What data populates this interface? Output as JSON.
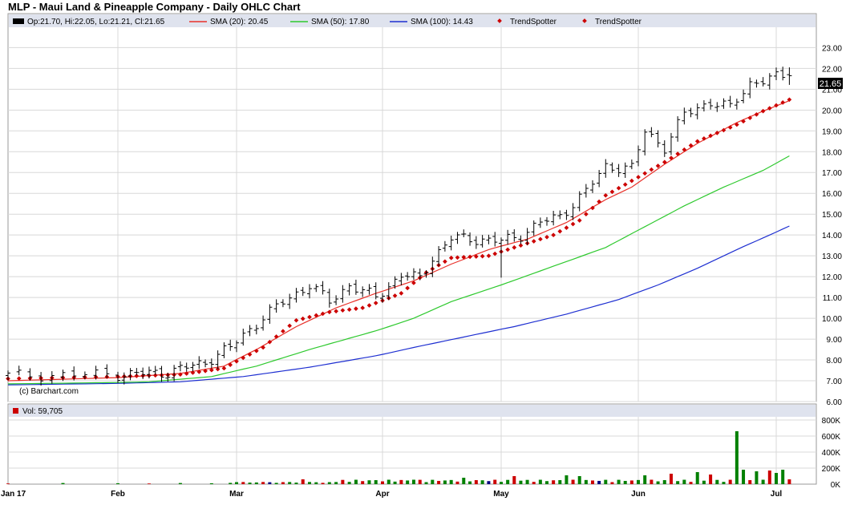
{
  "page": {
    "title": "MLP - Maui Land & Pineapple Company - Daily OHLC Chart"
  },
  "legend": {
    "ohlc": "Op:21.70, Hi:22.05, Lo:21.21, Cl:21.65",
    "sma20": "SMA (20): 20.45",
    "sma50": "SMA (50): 17.80",
    "sma100": "SMA (100): 14.43",
    "trend1": "TrendSpotter",
    "trend2": "TrendSpotter"
  },
  "volume_legend": "Vol: 59,705",
  "copyright": "(c) Barchart.com",
  "last_price_label": "21.65",
  "colors": {
    "price": "#000000",
    "sma20": "#e8312a",
    "sma50": "#2ec92e",
    "sma100": "#1e2fd1",
    "trendspotter": "#cc0000",
    "volume_up": "#008000",
    "volume_down": "#cc0000",
    "volume_neutral": "#000080",
    "grid": "#d8d8d8",
    "legend_bg": "#dfe3ee"
  },
  "chart_data": [
    {
      "type": "ohlc",
      "title": "MLP - Maui Land & Pineapple Company - Daily OHLC Chart",
      "y_ticks": [
        "6.00",
        "7.00",
        "8.00",
        "9.00",
        "10.00",
        "11.00",
        "12.00",
        "13.00",
        "14.00",
        "15.00",
        "16.00",
        "17.00",
        "18.00",
        "19.00",
        "20.00",
        "21.00",
        "22.00",
        "23.00"
      ],
      "ylim": [
        6,
        23.9
      ],
      "x_ticks": [
        "Jan 17",
        "Feb",
        "Mar",
        "Apr",
        "May",
        "Jun",
        "Jul"
      ],
      "grid": true,
      "x_anchors": [
        {
          "label": "Jan 17",
          "day": 0
        },
        {
          "label": "Feb",
          "day": 10
        },
        {
          "label": "Mar",
          "day": 29
        },
        {
          "label": "Apr",
          "day": 51
        },
        {
          "label": "May",
          "day": 70
        },
        {
          "label": "Jun",
          "day": 91
        },
        {
          "label": "Jul",
          "day": 112
        }
      ],
      "key_points": [
        {
          "day": 0,
          "close": 7.25
        },
        {
          "day": 10,
          "close": 7.3
        },
        {
          "day": 18,
          "close": 7.4
        },
        {
          "day": 24,
          "close": 7.9
        },
        {
          "day": 28,
          "close": 8.6
        },
        {
          "day": 31,
          "close": 9.5
        },
        {
          "day": 36,
          "close": 10.8
        },
        {
          "day": 40,
          "close": 11.6
        },
        {
          "day": 43,
          "close": 10.8
        },
        {
          "day": 46,
          "close": 11.6
        },
        {
          "day": 50,
          "close": 11.0
        },
        {
          "day": 54,
          "close": 12.1
        },
        {
          "day": 57,
          "close": 11.9
        },
        {
          "day": 59,
          "close": 12.9
        },
        {
          "day": 62,
          "close": 13.85
        },
        {
          "day": 66,
          "close": 13.8
        },
        {
          "day": 70,
          "close": 13.7
        },
        {
          "day": 73,
          "close": 14.0
        },
        {
          "day": 76,
          "close": 14.6
        },
        {
          "day": 79,
          "close": 14.9
        },
        {
          "day": 83,
          "close": 16.1
        },
        {
          "day": 86,
          "close": 17.3
        },
        {
          "day": 90,
          "close": 17.2
        },
        {
          "day": 92,
          "close": 19.0
        },
        {
          "day": 95,
          "close": 18.2
        },
        {
          "day": 98,
          "close": 19.8
        },
        {
          "day": 102,
          "close": 20.4
        },
        {
          "day": 105,
          "close": 20.1
        },
        {
          "day": 108,
          "close": 21.3
        },
        {
          "day": 111,
          "close": 21.5
        },
        {
          "day": 114,
          "close": 21.65
        }
      ],
      "last": {
        "open": 21.7,
        "high": 22.05,
        "low": 21.21,
        "close": 21.65
      },
      "series": [
        {
          "name": "SMA (20)",
          "points": [
            [
              0,
              7.0
            ],
            [
              10,
              7.15
            ],
            [
              20,
              7.35
            ],
            [
              27,
              7.7
            ],
            [
              32,
              8.5
            ],
            [
              38,
              9.6
            ],
            [
              44,
              10.5
            ],
            [
              50,
              11.2
            ],
            [
              56,
              11.8
            ],
            [
              62,
              12.6
            ],
            [
              68,
              13.3
            ],
            [
              74,
              13.8
            ],
            [
              80,
              14.6
            ],
            [
              86,
              15.7
            ],
            [
              90,
              16.3
            ],
            [
              95,
              17.4
            ],
            [
              100,
              18.4
            ],
            [
              106,
              19.4
            ],
            [
              110,
              19.95
            ],
            [
              114,
              20.45
            ]
          ]
        },
        {
          "name": "SMA (50)",
          "points": [
            [
              0,
              6.85
            ],
            [
              15,
              6.95
            ],
            [
              25,
              7.2
            ],
            [
              32,
              7.7
            ],
            [
              40,
              8.5
            ],
            [
              50,
              9.4
            ],
            [
              56,
              10.0
            ],
            [
              62,
              10.8
            ],
            [
              70,
              11.6
            ],
            [
              78,
              12.5
            ],
            [
              86,
              13.4
            ],
            [
              92,
              14.4
            ],
            [
              98,
              15.4
            ],
            [
              104,
              16.3
            ],
            [
              110,
              17.1
            ],
            [
              114,
              17.8
            ]
          ]
        },
        {
          "name": "SMA (100)",
          "points": [
            [
              0,
              6.8
            ],
            [
              20,
              6.95
            ],
            [
              30,
              7.2
            ],
            [
              40,
              7.65
            ],
            [
              50,
              8.2
            ],
            [
              56,
              8.6
            ],
            [
              64,
              9.1
            ],
            [
              72,
              9.6
            ],
            [
              80,
              10.2
            ],
            [
              88,
              10.9
            ],
            [
              94,
              11.6
            ],
            [
              100,
              12.4
            ],
            [
              106,
              13.3
            ],
            [
              111,
              14.0
            ],
            [
              114,
              14.43
            ]
          ]
        },
        {
          "name": "TrendSpotter",
          "points": [
            [
              0,
              7.1
            ],
            [
              10,
              7.2
            ],
            [
              20,
              7.3
            ],
            [
              27,
              7.6
            ],
            [
              33,
              8.6
            ],
            [
              38,
              9.9
            ],
            [
              43,
              10.3
            ],
            [
              48,
              10.5
            ],
            [
              54,
              11.2
            ],
            [
              58,
              12.2
            ],
            [
              62,
              12.9
            ],
            [
              68,
              13.0
            ],
            [
              72,
              13.4
            ],
            [
              78,
              14.0
            ],
            [
              82,
              14.7
            ],
            [
              86,
              15.9
            ],
            [
              90,
              16.6
            ],
            [
              95,
              17.5
            ],
            [
              100,
              18.5
            ],
            [
              106,
              19.3
            ],
            [
              110,
              19.95
            ],
            [
              114,
              20.5
            ]
          ]
        }
      ]
    },
    {
      "type": "bar",
      "title": "Volume",
      "y_ticks": [
        "0K",
        "200K",
        "400K",
        "600K",
        "800K"
      ],
      "ylim": [
        0,
        800000
      ],
      "last_volume": 59705,
      "spikes": [
        {
          "day": 39,
          "value": 60000
        },
        {
          "day": 56,
          "value": 55000
        },
        {
          "day": 64,
          "value": 80000
        },
        {
          "day": 72,
          "value": 100000
        },
        {
          "day": 80,
          "value": 110000
        },
        {
          "day": 82,
          "value": 100000
        },
        {
          "day": 92,
          "value": 110000
        },
        {
          "day": 96,
          "value": 130000
        },
        {
          "day": 100,
          "value": 150000
        },
        {
          "day": 102,
          "value": 120000
        },
        {
          "day": 106,
          "value": 660000
        },
        {
          "day": 107,
          "value": 180000
        },
        {
          "day": 109,
          "value": 160000
        },
        {
          "day": 111,
          "value": 170000
        },
        {
          "day": 112,
          "value": 140000
        },
        {
          "day": 113,
          "value": 180000
        }
      ]
    }
  ]
}
